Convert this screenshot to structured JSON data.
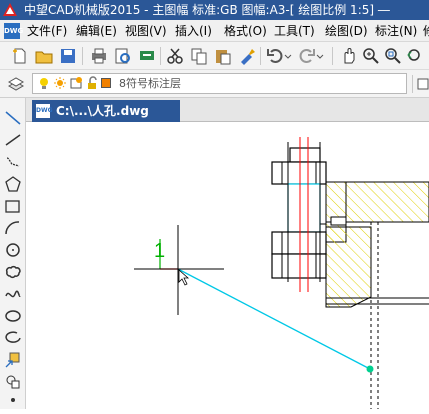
{
  "window": {
    "title": "中望CAD机械版2015 - 主图幅  标准:GB  图幅:A3-[ 绘图比例 1:5]  ―"
  },
  "app_icon_label": "DWG",
  "menubar": {
    "items": [
      "文件(F)",
      "编辑(E)",
      "视图(V)",
      "插入(I)",
      "格式(O)",
      "工具(T)",
      "绘图(D)",
      "标注(N)",
      "修"
    ]
  },
  "layer_toolbar": {
    "current_layer": "8符号标注层"
  },
  "document_tab": {
    "label": "C:\\...\\人孔.dwg",
    "icon_label": "DWG"
  },
  "canvas": {
    "ucs_y_label": "1"
  },
  "colors": {
    "titlebar": "#2b5797",
    "canvas_bg": "#ffffff",
    "crosshair": "#000000",
    "rubberband": "#00c8e6",
    "centerline": "#ff0000",
    "hatch": "#e0d000",
    "ucs_y": "#00b000",
    "ucs_x": "#ff0000"
  }
}
